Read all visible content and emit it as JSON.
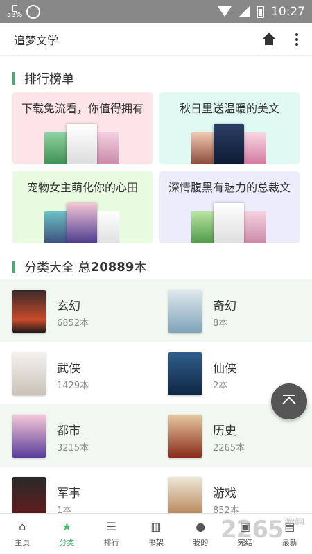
{
  "status_bar": {
    "battery_percent": "53%",
    "time": "10:27"
  },
  "app_header": {
    "title": "追梦文学",
    "home_icon": "home-icon",
    "more_icon": "more-vertical-icon"
  },
  "ranking": {
    "heading": "排行榜单",
    "cards": [
      {
        "title": "下载免流看，你值得拥有",
        "bg": "#fde4e8"
      },
      {
        "title": "秋日里送温暖的美文",
        "bg": "#e0faf3"
      },
      {
        "title": "宠物女主萌化你的心田",
        "bg": "#e8fbe0"
      },
      {
        "title": "深情腹黑有魅力的总裁文",
        "bg": "#ececfb"
      }
    ]
  },
  "categories": {
    "heading_prefix": "分类大全 总",
    "total": "20889",
    "heading_suffix": "本",
    "items": [
      {
        "name": "玄幻",
        "count": "6852本"
      },
      {
        "name": "奇幻",
        "count": "8本"
      },
      {
        "name": "武侠",
        "count": "1429本"
      },
      {
        "name": "仙侠",
        "count": "2本"
      },
      {
        "name": "都市",
        "count": "3215本"
      },
      {
        "name": "历史",
        "count": "2265本"
      },
      {
        "name": "军事",
        "count": "1本"
      },
      {
        "name": "游戏",
        "count": "852本"
      }
    ]
  },
  "fab_icon": "back-to-top-icon",
  "bottom_nav": [
    {
      "label": "主页",
      "icon": "home-icon"
    },
    {
      "label": "分类",
      "icon": "category-icon",
      "active": true
    },
    {
      "label": "排行",
      "icon": "ranking-list-icon"
    },
    {
      "label": "书架",
      "icon": "bookshelf-icon"
    },
    {
      "label": "我的",
      "icon": "user-icon"
    },
    {
      "label": "完结",
      "icon": "finished-icon"
    },
    {
      "label": "最新",
      "icon": "latest-icon"
    }
  ],
  "watermark": "2265",
  "watermark_small": "游戏网",
  "colors": {
    "accent": "#3cb371",
    "row_tint": "#f1f8f1",
    "status_bar": "#888888"
  }
}
